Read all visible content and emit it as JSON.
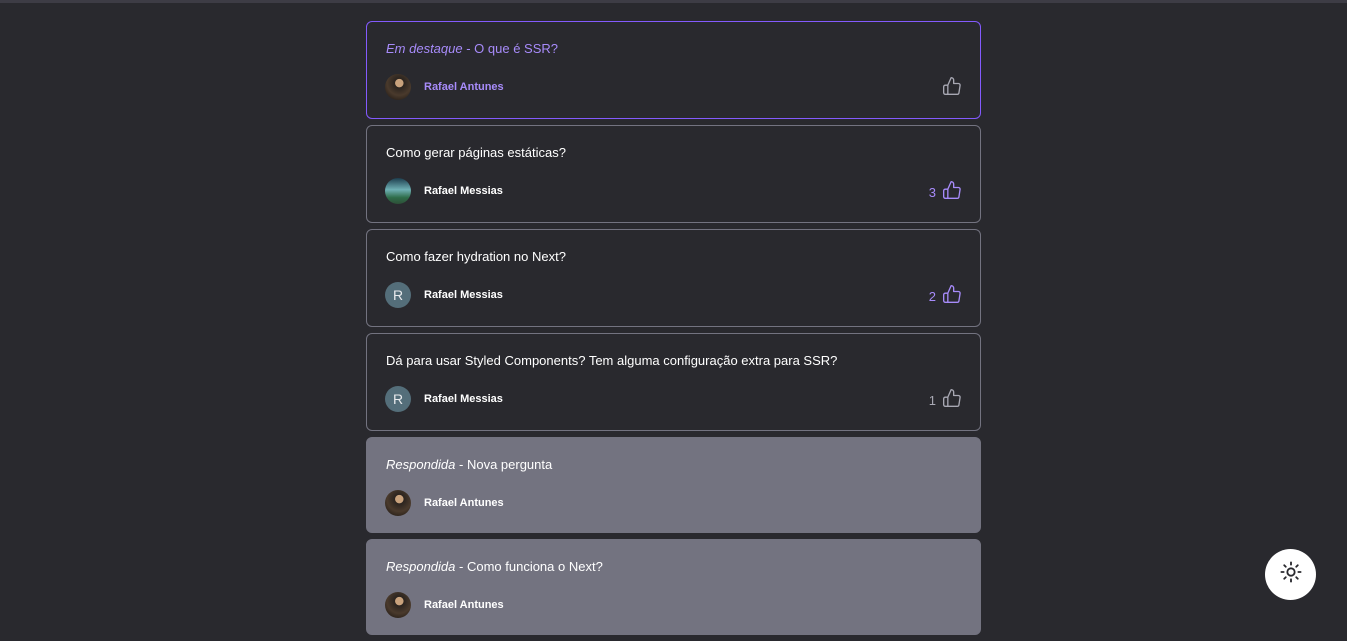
{
  "questions": [
    {
      "tag": "Em destaque",
      "separator": " - ",
      "text": "O que é SSR?",
      "author": "Rafael Antunes",
      "avatar": "photo-dark",
      "likes": "",
      "state": "highlighted"
    },
    {
      "tag": "",
      "separator": "",
      "text": "Como gerar páginas estáticas?",
      "author": "Rafael Messias",
      "avatar": "photo-blue",
      "likes": "3",
      "state": "normal"
    },
    {
      "tag": "",
      "separator": "",
      "text": "Como fazer hydration no Next?",
      "author": "Rafael Messias",
      "avatar_letter": "R",
      "likes": "2",
      "state": "normal"
    },
    {
      "tag": "",
      "separator": "",
      "text": "Dá para usar Styled Components? Tem alguma configuração extra para SSR?",
      "author": "Rafael Messias",
      "avatar_letter": "R",
      "likes": "1",
      "state": "normal"
    },
    {
      "tag": "Respondida",
      "separator": " - ",
      "text": "Nova pergunta",
      "author": "Rafael Antunes",
      "avatar": "photo-dark",
      "state": "answered"
    },
    {
      "tag": "Respondida",
      "separator": " - ",
      "text": "Como funciona o Next?",
      "author": "Rafael Antunes",
      "avatar": "photo-dark",
      "state": "answered"
    }
  ],
  "icons": {
    "like": "thumbs-up-icon",
    "theme": "sun-icon"
  },
  "colors": {
    "background": "#29292e",
    "accent": "#835afd",
    "answered_bg": "#737380",
    "border": "#737380"
  }
}
